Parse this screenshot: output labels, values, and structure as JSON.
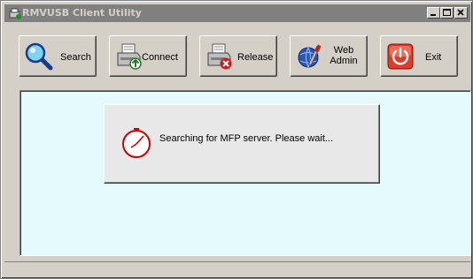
{
  "window": {
    "title": "RMVUSB Client Utility",
    "title_bar_color": "#808080"
  },
  "title_buttons": {
    "minimize_icon": "minimize-icon",
    "maximize_icon": "maximize-icon",
    "close_icon": "close-icon"
  },
  "toolbar": {
    "buttons": [
      {
        "label": "Search",
        "icon": "magnifier-icon"
      },
      {
        "label": "Connect",
        "icon": "printer-connect-icon"
      },
      {
        "label": "Release",
        "icon": "printer-release-icon"
      },
      {
        "label_line1": "Web",
        "label_line2": "Admin",
        "icon": "web-admin-tools-icon"
      },
      {
        "label": "Exit",
        "icon": "power-icon"
      }
    ]
  },
  "content": {
    "background": "#e5fafd"
  },
  "dialog": {
    "message": "Searching for MFP server. Please wait...",
    "icon": "clock-icon",
    "accent": "#cc0000"
  }
}
